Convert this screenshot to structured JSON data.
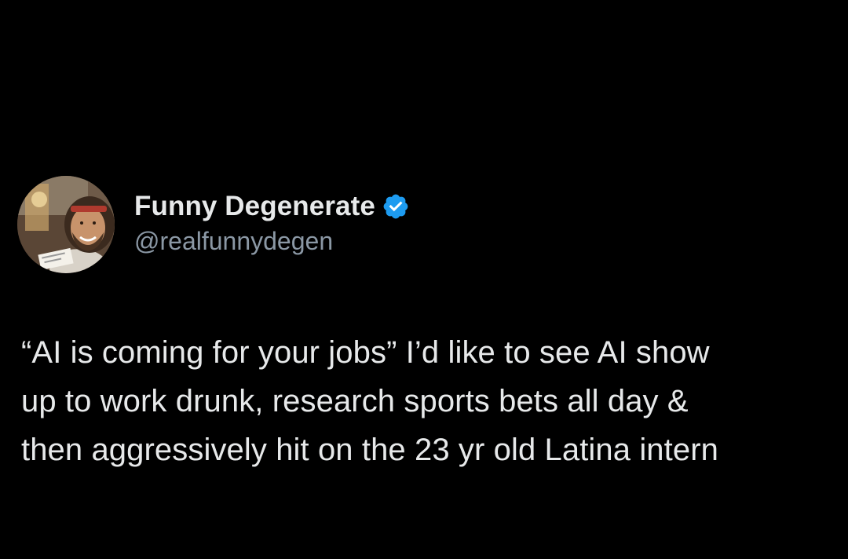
{
  "colors": {
    "background": "#000000",
    "text_primary": "#e7e9ea",
    "text_secondary": "#8b98a5",
    "verified_badge": "#1d9bf0"
  },
  "author": {
    "display_name": "Funny Degenerate",
    "handle": "@realfunnydegen",
    "verified": true,
    "verified_icon": "verified-badge-icon",
    "avatar_icon": "profile-avatar"
  },
  "tweet": {
    "text": "“AI is coming for your jobs” I’d like to see AI show\nup to work drunk, research sports bets all day &\nthen aggressively hit on the 23 yr old Latina intern"
  }
}
